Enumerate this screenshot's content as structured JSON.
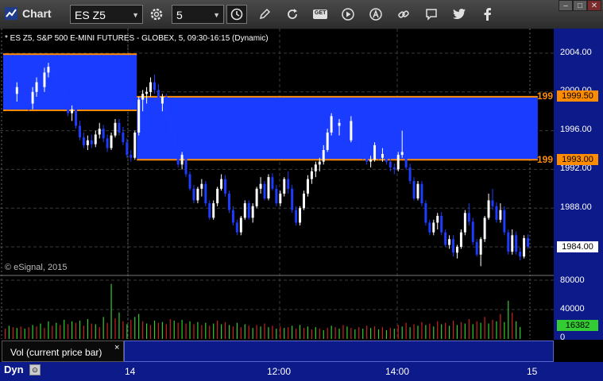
{
  "app": {
    "title": "Chart"
  },
  "toolbar": {
    "symbol": "ES Z5",
    "interval": "5",
    "tools": [
      "settings-icon",
      "clock-icon",
      "pencil-icon",
      "refresh-icon",
      "get-icon",
      "play-icon",
      "alert-icon",
      "link-icon",
      "comment-icon",
      "twitter-icon",
      "facebook-icon"
    ],
    "get_label": "GET"
  },
  "window_buttons": {
    "minimize": "–",
    "maximize": "□",
    "close": "✕"
  },
  "info_line": "* ES Z5, S&P 500 E-MINI FUTURES - GLOBEX, 5, 09:30-16:15 (Dynamic)",
  "watermark": "© eSignal, 2015",
  "price_axis": {
    "labels": [
      "2004.00",
      "2000.00",
      "1996.00",
      "1992.00",
      "1988.00",
      "1984.00"
    ],
    "current_price": "1984.00",
    "upper_level": "1999.50",
    "lower_level": "1993.00",
    "upper_level_short": "199",
    "lower_level_short": "199"
  },
  "volume_axis": {
    "labels": [
      "80000",
      "40000",
      "0"
    ],
    "current_volume": "16382"
  },
  "volume_panel": {
    "label": "Vol (current price bar)",
    "close": "×"
  },
  "time_axis": {
    "labels": [
      "14",
      "12:00",
      "14:00",
      "15"
    ]
  },
  "footer": {
    "mode": "Dyn",
    "icon": "lock-icon",
    "icon_glyph": "⊙"
  },
  "colors": {
    "up_bar": "#ffffff",
    "down_bar": "#1e3cff",
    "zone_fill": "#1a3cff",
    "level_line": "#ff8c00",
    "vol_up": "#33cc33",
    "vol_down": "#cc2222",
    "axis_bg": "#0c1a8a"
  },
  "chart_data": {
    "type": "candlestick",
    "ylim": [
      1980.5,
      2005.5
    ],
    "zones": [
      {
        "start_bar": 0,
        "end_bar": 33,
        "top": 2003.9,
        "bottom": 1998.1
      },
      {
        "start_bar": 34,
        "end_bar": 135,
        "top": 1999.5,
        "bottom": 1993.0
      }
    ],
    "bars": [
      [
        2002.5,
        2003.5,
        2000.5,
        2001.5
      ],
      [
        2001.5,
        2002.5,
        2000,
        2000.8
      ],
      [
        2000.8,
        2001.5,
        1999,
        1999.8
      ],
      [
        1999.8,
        2001,
        1999,
        2000.5
      ],
      [
        2000.5,
        2001.5,
        1999.5,
        2000
      ],
      [
        2000,
        2000.5,
        1998.5,
        1999
      ],
      [
        1999,
        2000,
        1998,
        1998.8
      ],
      [
        1998.8,
        2000.5,
        1998.2,
        2000
      ],
      [
        2000,
        2001.5,
        1999.5,
        2001
      ],
      [
        2001,
        2002,
        2000,
        2000.5
      ],
      [
        2000.5,
        2002.5,
        2000,
        2002
      ],
      [
        2002,
        2003,
        2001.5,
        2002.6
      ],
      [
        2002.6,
        2003.4,
        2001.6,
        2002
      ],
      [
        2002,
        2002.5,
        2000.5,
        2001
      ],
      [
        2001,
        2001.8,
        2000,
        2000.5
      ],
      [
        2000.5,
        2001,
        1999,
        1999.3
      ],
      [
        1999.3,
        1999.5,
        1997.5,
        1997.8
      ],
      [
        1997.8,
        1998.6,
        1997,
        1998.2
      ],
      [
        1998.2,
        1998.4,
        1996.2,
        1996.5
      ],
      [
        1996.5,
        1997,
        1995,
        1995.3
      ],
      [
        1995.3,
        1995.8,
        1994.2,
        1994.5
      ],
      [
        1994.5,
        1995.5,
        1994,
        1995
      ],
      [
        1995,
        1995.6,
        1994.2,
        1994.6
      ],
      [
        1994.6,
        1996,
        1994.3,
        1995.6
      ],
      [
        1995.6,
        1996.8,
        1995.2,
        1996.2
      ],
      [
        1996.2,
        1996.6,
        1994.8,
        1995.2
      ],
      [
        1995.2,
        1995.6,
        1993.8,
        1994.2
      ],
      [
        1994.2,
        1995.8,
        1994,
        1995.5
      ],
      [
        1995.5,
        1997.2,
        1995.3,
        1996.8
      ],
      [
        1996.8,
        1997.2,
        1995.5,
        1995.8
      ],
      [
        1995.8,
        1996.4,
        1994.5,
        1994.8
      ],
      [
        1994.8,
        1995.2,
        1993.2,
        1993.5
      ],
      [
        1993.5,
        1994,
        1992.8,
        1993.2
      ],
      [
        1993.2,
        1996,
        1993,
        1995.8
      ],
      [
        1995.8,
        1999.5,
        1995.5,
        1999.2
      ],
      [
        1999.2,
        2000.2,
        1998,
        1999.8
      ],
      [
        1999.8,
        2000.5,
        1998.8,
        2000
      ],
      [
        2000,
        2001.5,
        1999.5,
        2001
      ],
      [
        2001,
        2001.8,
        1999.8,
        2000.2
      ],
      [
        2000.2,
        2000.8,
        1998.5,
        1998.8
      ],
      [
        1998.8,
        1999.8,
        1998,
        1999.5
      ],
      [
        1999.5,
        1999.8,
        1997.2,
        1997.5
      ],
      [
        1997.5,
        1997.8,
        1995.5,
        1995.8
      ],
      [
        1995.8,
        1996.2,
        1993.8,
        1994
      ],
      [
        1994,
        1994.4,
        1992.2,
        1992.5
      ],
      [
        1992.5,
        1993.8,
        1992,
        1993.5
      ],
      [
        1993.5,
        1994,
        1991.2,
        1991.5
      ],
      [
        1991.5,
        1991.8,
        1989.8,
        1990
      ],
      [
        1990,
        1990.4,
        1988.5,
        1988.8
      ],
      [
        1988.8,
        1990.2,
        1988.5,
        1990
      ],
      [
        1990,
        1991,
        1989.2,
        1990.5
      ],
      [
        1990.5,
        1990.8,
        1988.2,
        1988.5
      ],
      [
        1988.5,
        1988.8,
        1986.8,
        1987
      ],
      [
        1987,
        1988.8,
        1986.8,
        1988.5
      ],
      [
        1988.5,
        1990.2,
        1988.2,
        1990
      ],
      [
        1990,
        1991.5,
        1989.8,
        1991
      ],
      [
        1991,
        1991.4,
        1989.2,
        1989.5
      ],
      [
        1989.5,
        1989.8,
        1987.5,
        1987.8
      ],
      [
        1987.8,
        1988.2,
        1986.2,
        1986.5
      ],
      [
        1986.5,
        1986.8,
        1985.2,
        1985.5
      ],
      [
        1985.5,
        1987.2,
        1985.2,
        1987
      ],
      [
        1987,
        1988.8,
        1986.8,
        1988.5
      ],
      [
        1988.5,
        1988.8,
        1986.8,
        1987
      ],
      [
        1987,
        1988.5,
        1986.5,
        1988.2
      ],
      [
        1988.2,
        1990.2,
        1988,
        1990
      ],
      [
        1990,
        1991.2,
        1989.5,
        1990.5
      ],
      [
        1990.5,
        1990.8,
        1988.8,
        1989
      ],
      [
        1989,
        1991.5,
        1988.8,
        1991.2
      ],
      [
        1991.2,
        1991.6,
        1989.8,
        1990
      ],
      [
        1990,
        1990.4,
        1988.2,
        1988.5
      ],
      [
        1988.5,
        1989.8,
        1988.2,
        1989.5
      ],
      [
        1989.5,
        1991.2,
        1989.2,
        1991
      ],
      [
        1991,
        1991.8,
        1989.5,
        1990
      ],
      [
        1990,
        1990.4,
        1987.5,
        1987.8
      ],
      [
        1987.8,
        1988.2,
        1986.2,
        1986.5
      ],
      [
        1986.5,
        1988.2,
        1986.2,
        1988
      ],
      [
        1988,
        1989.8,
        1987.8,
        1989.5
      ],
      [
        1989.5,
        1991.4,
        1989.2,
        1991
      ],
      [
        1991,
        1992.2,
        1990.5,
        1991.8
      ],
      [
        1991.8,
        1992.8,
        1991.2,
        1992.5
      ],
      [
        1992.5,
        1993.2,
        1991.8,
        1992.8
      ],
      [
        1992.8,
        1994.5,
        1992.5,
        1994
      ],
      [
        1994,
        1996.2,
        1993.8,
        1995.8
      ],
      [
        1995.8,
        1997.8,
        1995.5,
        1997.5
      ],
      [
        1997.5,
        1998.2,
        1996,
        1996.5
      ],
      [
        1996.5,
        1997.2,
        1995.5,
        1996.8
      ],
      [
        1996.8,
        1997.2,
        1995.2,
        1995.5
      ],
      [
        1995.5,
        1996.2,
        1994.5,
        1995
      ],
      [
        1995,
        1997.5,
        1994.8,
        1997
      ],
      [
        1997,
        1997.5,
        1994.8,
        1995.2
      ],
      [
        1995.2,
        1995.6,
        1993.5,
        1993.8
      ],
      [
        1993.8,
        1994.4,
        1993,
        1993.5
      ],
      [
        1993.5,
        1994,
        1992.5,
        1992.8
      ],
      [
        1992.8,
        1993.4,
        1992.2,
        1993
      ],
      [
        1993,
        1994.8,
        1992.8,
        1994.5
      ],
      [
        1994.5,
        1994.8,
        1993,
        1993.2
      ],
      [
        1993.2,
        1994.2,
        1992.8,
        1993.6
      ],
      [
        1993.6,
        1994,
        1992.5,
        1992.8
      ],
      [
        1992.8,
        1993.2,
        1991.8,
        1992.2
      ],
      [
        1992.2,
        1992.6,
        1991.5,
        1992
      ],
      [
        1992,
        1993.8,
        1991.8,
        1993.5
      ],
      [
        1993.5,
        1996,
        1993.2,
        1993.8
      ],
      [
        1993.8,
        1994.2,
        1992,
        1992.2
      ],
      [
        1992.2,
        1992.6,
        1990.5,
        1990.8
      ],
      [
        1990.8,
        1991.2,
        1988.8,
        1989
      ],
      [
        1989,
        1990.8,
        1988.8,
        1990.5
      ],
      [
        1990.5,
        1990.8,
        1988.2,
        1988.5
      ],
      [
        1988.5,
        1988.8,
        1986.2,
        1986.5
      ],
      [
        1986.5,
        1986.8,
        1985.2,
        1985.5
      ],
      [
        1985.5,
        1986.8,
        1985.2,
        1986.5
      ],
      [
        1986.5,
        1987.5,
        1985.8,
        1987.2
      ],
      [
        1987.2,
        1987.6,
        1985.2,
        1985.5
      ],
      [
        1985.5,
        1985.8,
        1984,
        1984.2
      ],
      [
        1984.2,
        1985.2,
        1983.8,
        1984.8
      ],
      [
        1984.8,
        1985.2,
        1983,
        1983.4
      ],
      [
        1983.4,
        1984.2,
        1982.8,
        1984
      ],
      [
        1984,
        1985.8,
        1983.8,
        1985.5
      ],
      [
        1985.5,
        1987.8,
        1985.2,
        1987.5
      ],
      [
        1987.5,
        1988.5,
        1986.2,
        1986.6
      ],
      [
        1986.6,
        1987,
        1984.2,
        1984.5
      ],
      [
        1984.5,
        1984.8,
        1983,
        1983.2
      ],
      [
        1983.2,
        1985,
        1982,
        1984.8
      ],
      [
        1984.8,
        1987.2,
        1984.5,
        1987
      ],
      [
        1987,
        1989.5,
        1986.8,
        1988.8
      ],
      [
        1988.8,
        1990,
        1987.8,
        1988.2
      ],
      [
        1988.2,
        1988.6,
        1986.5,
        1986.8
      ],
      [
        1986.8,
        1988.5,
        1986.5,
        1987.8
      ],
      [
        1987.8,
        1988.2,
        1985.2,
        1985.5
      ],
      [
        1985.5,
        1985.8,
        1983.2,
        1983.5
      ],
      [
        1983.5,
        1985.8,
        1983.2,
        1985.2
      ],
      [
        1985.2,
        1985.6,
        1983.2,
        1983.5
      ],
      [
        1983.5,
        1983.9,
        1982.6,
        1983
      ],
      [
        1983,
        1985.2,
        1982.8,
        1984.9
      ],
      [
        1984.9,
        1985.3,
        1983.8,
        1984
      ]
    ],
    "volume_ylim": [
      0,
      80000
    ],
    "volume": [
      [
        14000,
        "d"
      ],
      [
        18000,
        "u"
      ],
      [
        16000,
        "d"
      ],
      [
        15000,
        "u"
      ],
      [
        17000,
        "d"
      ],
      [
        14000,
        "u"
      ],
      [
        16000,
        "d"
      ],
      [
        19000,
        "u"
      ],
      [
        17000,
        "d"
      ],
      [
        21000,
        "u"
      ],
      [
        15000,
        "d"
      ],
      [
        24000,
        "u"
      ],
      [
        18000,
        "d"
      ],
      [
        22000,
        "u"
      ],
      [
        19000,
        "d"
      ],
      [
        26000,
        "u"
      ],
      [
        20000,
        "d"
      ],
      [
        24000,
        "u"
      ],
      [
        22000,
        "d"
      ],
      [
        25000,
        "u"
      ],
      [
        18000,
        "d"
      ],
      [
        27000,
        "u"
      ],
      [
        21000,
        "d"
      ],
      [
        20000,
        "u"
      ],
      [
        16000,
        "d"
      ],
      [
        30000,
        "u"
      ],
      [
        22000,
        "d"
      ],
      [
        75000,
        "u"
      ],
      [
        28000,
        "d"
      ],
      [
        36000,
        "u"
      ],
      [
        24000,
        "d"
      ],
      [
        20000,
        "u"
      ],
      [
        26000,
        "d"
      ],
      [
        30000,
        "u"
      ],
      [
        34000,
        "u"
      ],
      [
        24000,
        "d"
      ],
      [
        21000,
        "u"
      ],
      [
        19000,
        "d"
      ],
      [
        25000,
        "u"
      ],
      [
        22000,
        "d"
      ],
      [
        23000,
        "u"
      ],
      [
        20000,
        "d"
      ],
      [
        27000,
        "d"
      ],
      [
        25000,
        "u"
      ],
      [
        22000,
        "d"
      ],
      [
        26000,
        "u"
      ],
      [
        21000,
        "d"
      ],
      [
        24000,
        "u"
      ],
      [
        20000,
        "d"
      ],
      [
        23000,
        "u"
      ],
      [
        19000,
        "d"
      ],
      [
        22000,
        "u"
      ],
      [
        18000,
        "d"
      ],
      [
        21000,
        "u"
      ],
      [
        25000,
        "d"
      ],
      [
        20000,
        "u"
      ],
      [
        23000,
        "d"
      ],
      [
        19000,
        "u"
      ],
      [
        17000,
        "d"
      ],
      [
        22000,
        "u"
      ],
      [
        16000,
        "d"
      ],
      [
        20000,
        "u"
      ],
      [
        18000,
        "d"
      ],
      [
        15000,
        "u"
      ],
      [
        19000,
        "d"
      ],
      [
        17000,
        "u"
      ],
      [
        21000,
        "d"
      ],
      [
        16000,
        "u"
      ],
      [
        18000,
        "d"
      ],
      [
        14000,
        "u"
      ],
      [
        17000,
        "d"
      ],
      [
        15000,
        "u"
      ],
      [
        16000,
        "d"
      ],
      [
        18000,
        "u"
      ],
      [
        14000,
        "d"
      ],
      [
        19000,
        "u"
      ],
      [
        15000,
        "d"
      ],
      [
        17000,
        "u"
      ],
      [
        13000,
        "d"
      ],
      [
        16000,
        "u"
      ],
      [
        14000,
        "d"
      ],
      [
        12000,
        "u"
      ],
      [
        15000,
        "d"
      ],
      [
        18000,
        "u"
      ],
      [
        16000,
        "d"
      ],
      [
        14000,
        "u"
      ],
      [
        19000,
        "d"
      ],
      [
        17000,
        "u"
      ],
      [
        15000,
        "d"
      ],
      [
        13000,
        "u"
      ],
      [
        16000,
        "d"
      ],
      [
        14000,
        "u"
      ],
      [
        18000,
        "d"
      ],
      [
        15000,
        "u"
      ],
      [
        17000,
        "d"
      ],
      [
        13000,
        "u"
      ],
      [
        16000,
        "d"
      ],
      [
        12000,
        "u"
      ],
      [
        15000,
        "d"
      ],
      [
        14000,
        "u"
      ],
      [
        19000,
        "d"
      ],
      [
        17000,
        "u"
      ],
      [
        22000,
        "d"
      ],
      [
        16000,
        "u"
      ],
      [
        20000,
        "d"
      ],
      [
        18000,
        "u"
      ],
      [
        23000,
        "d"
      ],
      [
        19000,
        "u"
      ],
      [
        21000,
        "d"
      ],
      [
        17000,
        "u"
      ],
      [
        24000,
        "d"
      ],
      [
        20000,
        "u"
      ],
      [
        22000,
        "d"
      ],
      [
        18000,
        "u"
      ],
      [
        25000,
        "d"
      ],
      [
        19000,
        "u"
      ],
      [
        23000,
        "d"
      ],
      [
        21000,
        "u"
      ],
      [
        27000,
        "d"
      ],
      [
        20000,
        "u"
      ],
      [
        24000,
        "d"
      ],
      [
        22000,
        "u"
      ],
      [
        30000,
        "d"
      ],
      [
        21000,
        "u"
      ],
      [
        26000,
        "d"
      ],
      [
        24000,
        "u"
      ],
      [
        34000,
        "d"
      ],
      [
        23000,
        "u"
      ],
      [
        52000,
        "u"
      ],
      [
        36000,
        "d"
      ],
      [
        24000,
        "u"
      ],
      [
        16382,
        "u"
      ]
    ]
  }
}
